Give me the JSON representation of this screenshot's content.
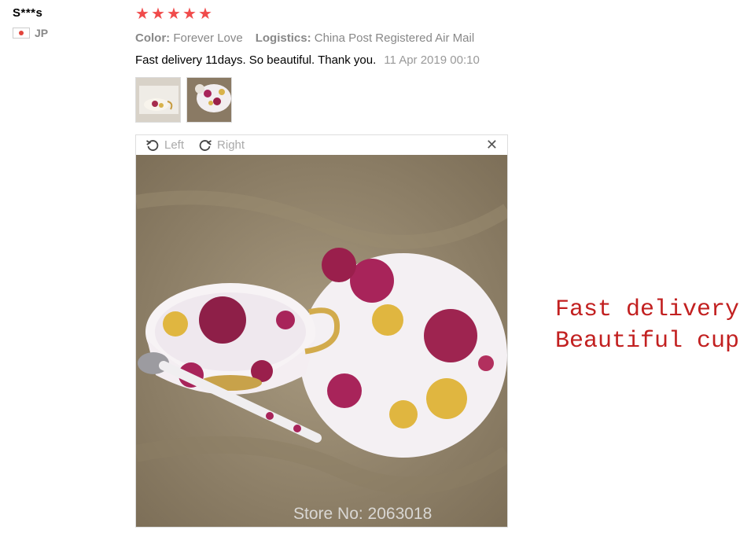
{
  "reviewer": {
    "name": "S***s",
    "country_code": "JP"
  },
  "rating": {
    "stars": 5,
    "star_glyph": "★",
    "color": "#f04b4b"
  },
  "details": {
    "color_label": "Color:",
    "color_value": "Forever Love",
    "logistics_label": "Logistics:",
    "logistics_value": "China Post Registered Air Mail"
  },
  "review": {
    "text": "Fast delivery 11days. So beautiful. Thank you.",
    "date": "11 Apr 2019 00:10"
  },
  "viewer": {
    "left_label": "Left",
    "right_label": "Right",
    "close_glyph": "✕"
  },
  "watermark": "Store No: 2063018",
  "side_note": {
    "line1": "Fast delivery √",
    "line2": "Beautiful cup √",
    "color": "#c22020"
  }
}
